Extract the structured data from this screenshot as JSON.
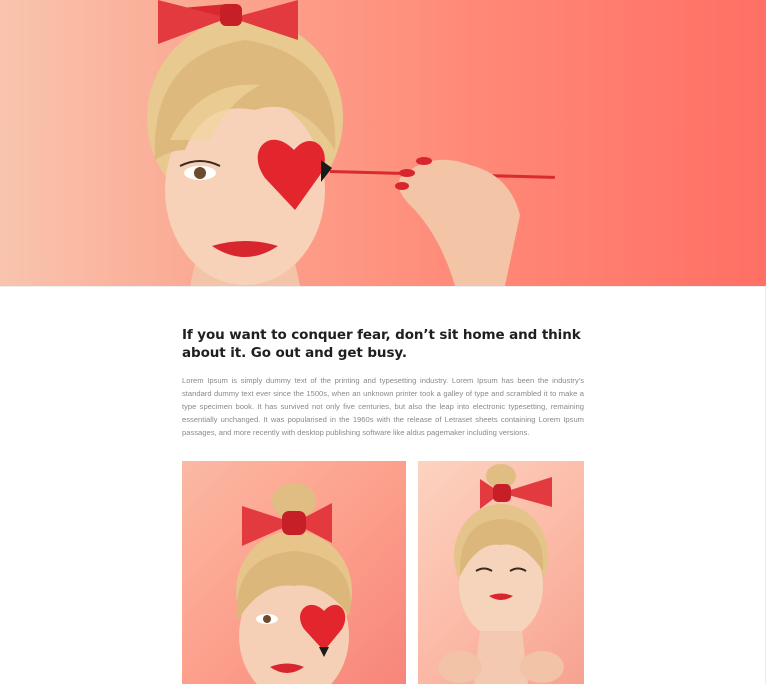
{
  "hero": {
    "image": "portrait-heart-eye-photo",
    "background_colors": [
      "#f9c4ad",
      "#ff6f64"
    ]
  },
  "article": {
    "headline": "If you want to conquer fear, don’t sit home and think about it. Go out and get busy.",
    "body": "Lorem Ipsum is simply dummy text of the printing and typesetting industry. Lorem Ipsum has been the industry's standard dummy text ever since the 1500s, when an unknown printer took a galley of type and scrambled it to make a type specimen book. It has survived not only five centuries, but also the leap into electronic typesetting, remaining essentially unchanged. It was popularised in the 1960s with the release of Letraset sheets containing Lorem Ipsum passages, and more recently with desktop publishing software like aldus pagemaker including versions."
  },
  "gallery": [
    {
      "image": "portrait-heart-photo"
    },
    {
      "image": "portrait-bow-photo"
    }
  ],
  "colors": {
    "accent": "#e8212f",
    "text": "#1f1f1f",
    "muted": "#8a8a8a"
  }
}
